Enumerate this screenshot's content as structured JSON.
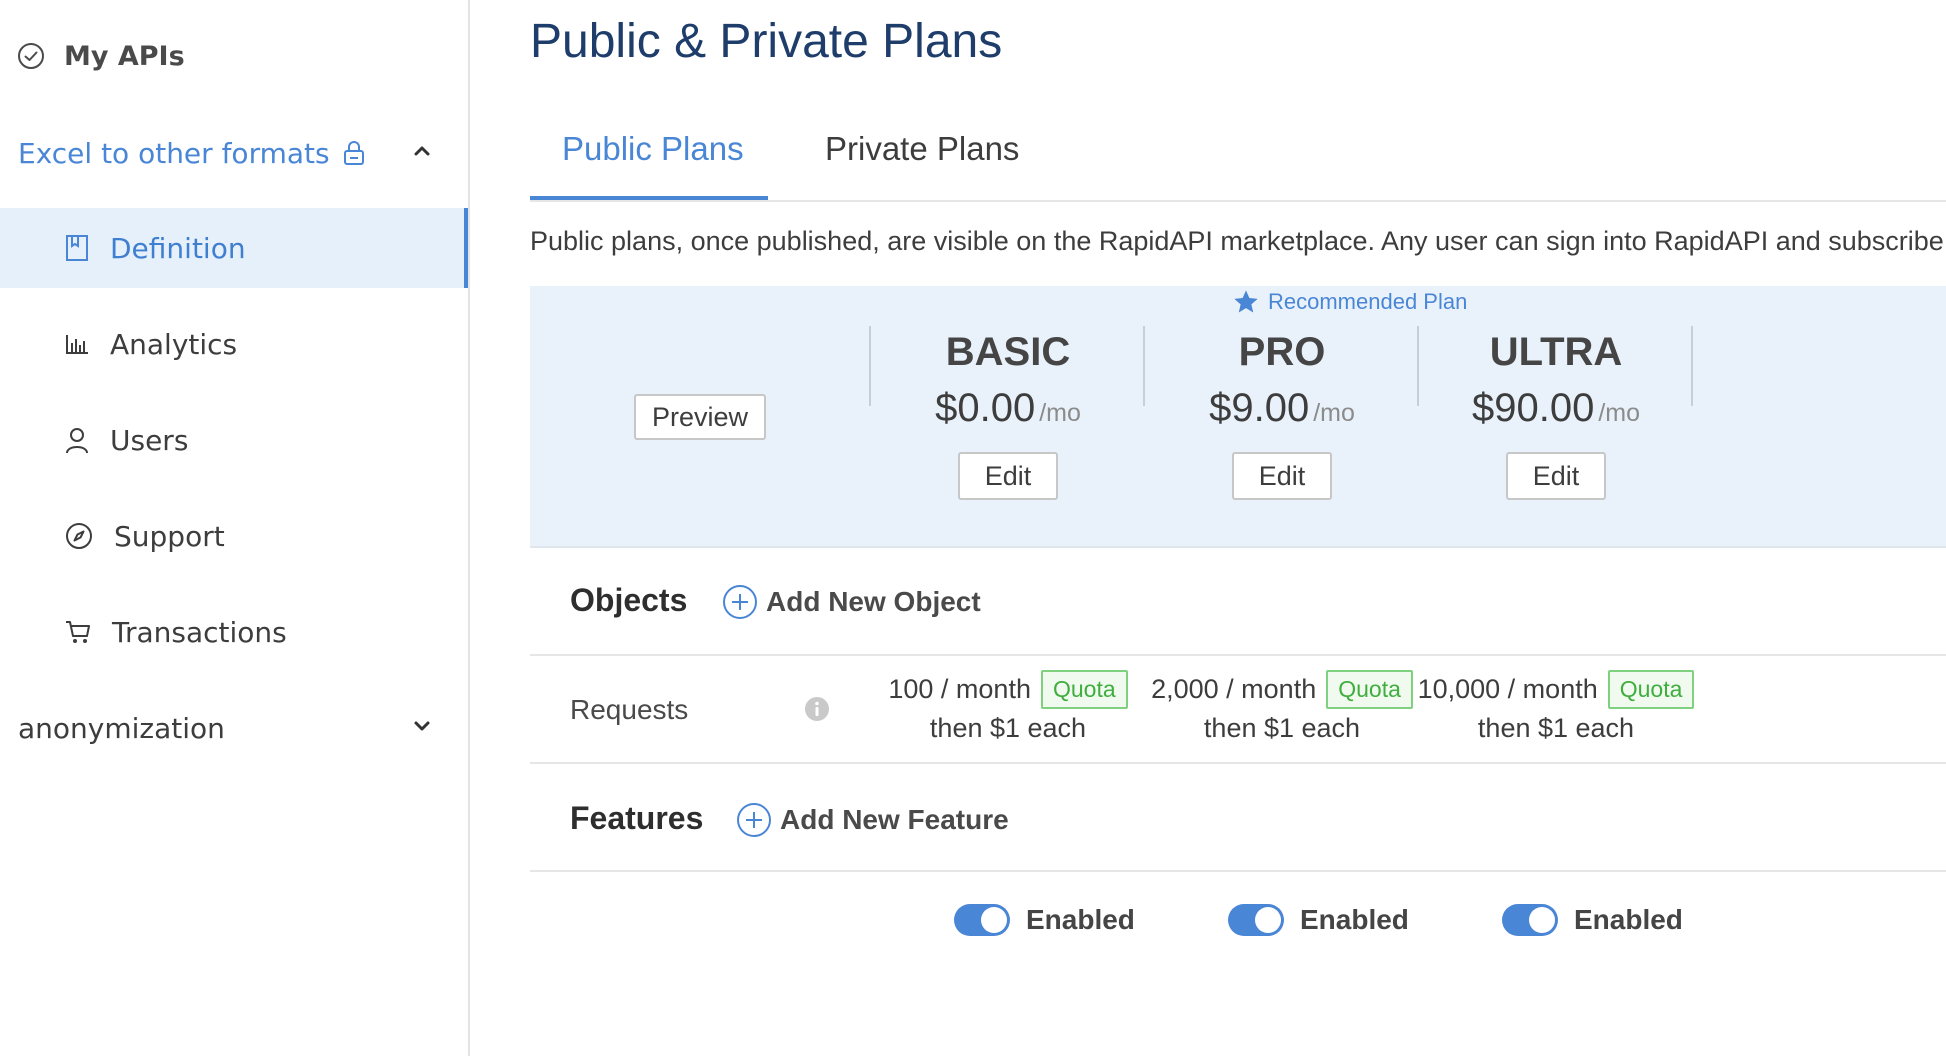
{
  "sidebar": {
    "my_apis": {
      "label": "My APIs",
      "icon": "check-circle-icon"
    },
    "api": {
      "label": "Excel to other formats",
      "icon": "lock-icon",
      "expanded": true
    },
    "items": [
      {
        "label": "Definition",
        "icon": "book-icon",
        "active": true
      },
      {
        "label": "Analytics",
        "icon": "bar-chart-icon",
        "active": false
      },
      {
        "label": "Users",
        "icon": "user-icon",
        "active": false
      },
      {
        "label": "Support",
        "icon": "compass-icon",
        "active": false
      },
      {
        "label": "Transactions",
        "icon": "cart-icon",
        "active": false
      }
    ],
    "other_api": {
      "label": "anonymization",
      "expanded": false
    }
  },
  "page": {
    "title": "Public & Private Plans",
    "tabs": [
      {
        "label": "Public Plans",
        "active": true
      },
      {
        "label": "Private Plans",
        "active": false
      }
    ],
    "description": "Public plans, once published, are visible on the RapidAPI marketplace. Any user can sign into RapidAPI and subscribe t"
  },
  "plans": {
    "preview_label": "Preview",
    "recommended_label": "Recommended Plan",
    "edit_label": "Edit",
    "per_label": "/mo",
    "list": [
      {
        "name": "BASIC",
        "price": "$0.00"
      },
      {
        "name": "PRO",
        "price": "$9.00"
      },
      {
        "name": "ULTRA",
        "price": "$90.00"
      }
    ]
  },
  "objects": {
    "title": "Objects",
    "add_label": "Add New Object",
    "requests": {
      "label": "Requests",
      "cells": [
        {
          "amount": "100 / month",
          "badge": "Quota",
          "overage": "then $1 each"
        },
        {
          "amount": "2,000 / month",
          "badge": "Quota",
          "overage": "then $1 each"
        },
        {
          "amount": "10,000 / month",
          "badge": "Quota",
          "overage": "then $1 each"
        }
      ]
    }
  },
  "features": {
    "title": "Features",
    "add_label": "Add New Feature",
    "toggles": [
      {
        "label": "Enabled",
        "on": true
      },
      {
        "label": "Enabled",
        "on": true
      },
      {
        "label": "Enabled",
        "on": true
      }
    ]
  },
  "colors": {
    "accent": "#4a86d6",
    "title": "#1f3d6b",
    "plan_bg": "#e9f2fb",
    "quota_green": "#3fae3f"
  }
}
